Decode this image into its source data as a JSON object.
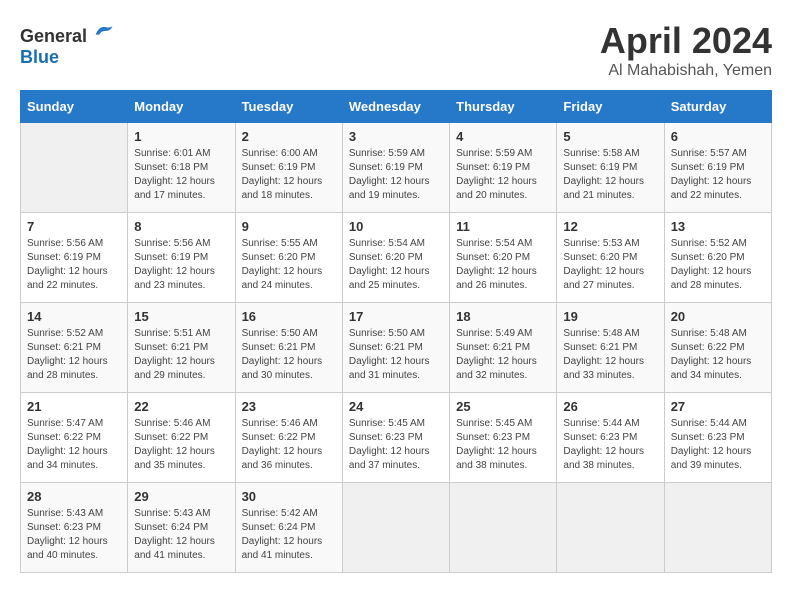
{
  "header": {
    "logo_general": "General",
    "logo_blue": "Blue",
    "month_title": "April 2024",
    "location": "Al Mahabishah, Yemen"
  },
  "days_of_week": [
    "Sunday",
    "Monday",
    "Tuesday",
    "Wednesday",
    "Thursday",
    "Friday",
    "Saturday"
  ],
  "weeks": [
    [
      {
        "day": "",
        "sunrise": "",
        "sunset": "",
        "daylight": ""
      },
      {
        "day": "1",
        "sunrise": "Sunrise: 6:01 AM",
        "sunset": "Sunset: 6:18 PM",
        "daylight": "Daylight: 12 hours and 17 minutes."
      },
      {
        "day": "2",
        "sunrise": "Sunrise: 6:00 AM",
        "sunset": "Sunset: 6:19 PM",
        "daylight": "Daylight: 12 hours and 18 minutes."
      },
      {
        "day": "3",
        "sunrise": "Sunrise: 5:59 AM",
        "sunset": "Sunset: 6:19 PM",
        "daylight": "Daylight: 12 hours and 19 minutes."
      },
      {
        "day": "4",
        "sunrise": "Sunrise: 5:59 AM",
        "sunset": "Sunset: 6:19 PM",
        "daylight": "Daylight: 12 hours and 20 minutes."
      },
      {
        "day": "5",
        "sunrise": "Sunrise: 5:58 AM",
        "sunset": "Sunset: 6:19 PM",
        "daylight": "Daylight: 12 hours and 21 minutes."
      },
      {
        "day": "6",
        "sunrise": "Sunrise: 5:57 AM",
        "sunset": "Sunset: 6:19 PM",
        "daylight": "Daylight: 12 hours and 22 minutes."
      }
    ],
    [
      {
        "day": "7",
        "sunrise": "Sunrise: 5:56 AM",
        "sunset": "Sunset: 6:19 PM",
        "daylight": "Daylight: 12 hours and 22 minutes."
      },
      {
        "day": "8",
        "sunrise": "Sunrise: 5:56 AM",
        "sunset": "Sunset: 6:19 PM",
        "daylight": "Daylight: 12 hours and 23 minutes."
      },
      {
        "day": "9",
        "sunrise": "Sunrise: 5:55 AM",
        "sunset": "Sunset: 6:20 PM",
        "daylight": "Daylight: 12 hours and 24 minutes."
      },
      {
        "day": "10",
        "sunrise": "Sunrise: 5:54 AM",
        "sunset": "Sunset: 6:20 PM",
        "daylight": "Daylight: 12 hours and 25 minutes."
      },
      {
        "day": "11",
        "sunrise": "Sunrise: 5:54 AM",
        "sunset": "Sunset: 6:20 PM",
        "daylight": "Daylight: 12 hours and 26 minutes."
      },
      {
        "day": "12",
        "sunrise": "Sunrise: 5:53 AM",
        "sunset": "Sunset: 6:20 PM",
        "daylight": "Daylight: 12 hours and 27 minutes."
      },
      {
        "day": "13",
        "sunrise": "Sunrise: 5:52 AM",
        "sunset": "Sunset: 6:20 PM",
        "daylight": "Daylight: 12 hours and 28 minutes."
      }
    ],
    [
      {
        "day": "14",
        "sunrise": "Sunrise: 5:52 AM",
        "sunset": "Sunset: 6:21 PM",
        "daylight": "Daylight: 12 hours and 28 minutes."
      },
      {
        "day": "15",
        "sunrise": "Sunrise: 5:51 AM",
        "sunset": "Sunset: 6:21 PM",
        "daylight": "Daylight: 12 hours and 29 minutes."
      },
      {
        "day": "16",
        "sunrise": "Sunrise: 5:50 AM",
        "sunset": "Sunset: 6:21 PM",
        "daylight": "Daylight: 12 hours and 30 minutes."
      },
      {
        "day": "17",
        "sunrise": "Sunrise: 5:50 AM",
        "sunset": "Sunset: 6:21 PM",
        "daylight": "Daylight: 12 hours and 31 minutes."
      },
      {
        "day": "18",
        "sunrise": "Sunrise: 5:49 AM",
        "sunset": "Sunset: 6:21 PM",
        "daylight": "Daylight: 12 hours and 32 minutes."
      },
      {
        "day": "19",
        "sunrise": "Sunrise: 5:48 AM",
        "sunset": "Sunset: 6:21 PM",
        "daylight": "Daylight: 12 hours and 33 minutes."
      },
      {
        "day": "20",
        "sunrise": "Sunrise: 5:48 AM",
        "sunset": "Sunset: 6:22 PM",
        "daylight": "Daylight: 12 hours and 34 minutes."
      }
    ],
    [
      {
        "day": "21",
        "sunrise": "Sunrise: 5:47 AM",
        "sunset": "Sunset: 6:22 PM",
        "daylight": "Daylight: 12 hours and 34 minutes."
      },
      {
        "day": "22",
        "sunrise": "Sunrise: 5:46 AM",
        "sunset": "Sunset: 6:22 PM",
        "daylight": "Daylight: 12 hours and 35 minutes."
      },
      {
        "day": "23",
        "sunrise": "Sunrise: 5:46 AM",
        "sunset": "Sunset: 6:22 PM",
        "daylight": "Daylight: 12 hours and 36 minutes."
      },
      {
        "day": "24",
        "sunrise": "Sunrise: 5:45 AM",
        "sunset": "Sunset: 6:23 PM",
        "daylight": "Daylight: 12 hours and 37 minutes."
      },
      {
        "day": "25",
        "sunrise": "Sunrise: 5:45 AM",
        "sunset": "Sunset: 6:23 PM",
        "daylight": "Daylight: 12 hours and 38 minutes."
      },
      {
        "day": "26",
        "sunrise": "Sunrise: 5:44 AM",
        "sunset": "Sunset: 6:23 PM",
        "daylight": "Daylight: 12 hours and 38 minutes."
      },
      {
        "day": "27",
        "sunrise": "Sunrise: 5:44 AM",
        "sunset": "Sunset: 6:23 PM",
        "daylight": "Daylight: 12 hours and 39 minutes."
      }
    ],
    [
      {
        "day": "28",
        "sunrise": "Sunrise: 5:43 AM",
        "sunset": "Sunset: 6:23 PM",
        "daylight": "Daylight: 12 hours and 40 minutes."
      },
      {
        "day": "29",
        "sunrise": "Sunrise: 5:43 AM",
        "sunset": "Sunset: 6:24 PM",
        "daylight": "Daylight: 12 hours and 41 minutes."
      },
      {
        "day": "30",
        "sunrise": "Sunrise: 5:42 AM",
        "sunset": "Sunset: 6:24 PM",
        "daylight": "Daylight: 12 hours and 41 minutes."
      },
      {
        "day": "",
        "sunrise": "",
        "sunset": "",
        "daylight": ""
      },
      {
        "day": "",
        "sunrise": "",
        "sunset": "",
        "daylight": ""
      },
      {
        "day": "",
        "sunrise": "",
        "sunset": "",
        "daylight": ""
      },
      {
        "day": "",
        "sunrise": "",
        "sunset": "",
        "daylight": ""
      }
    ]
  ]
}
